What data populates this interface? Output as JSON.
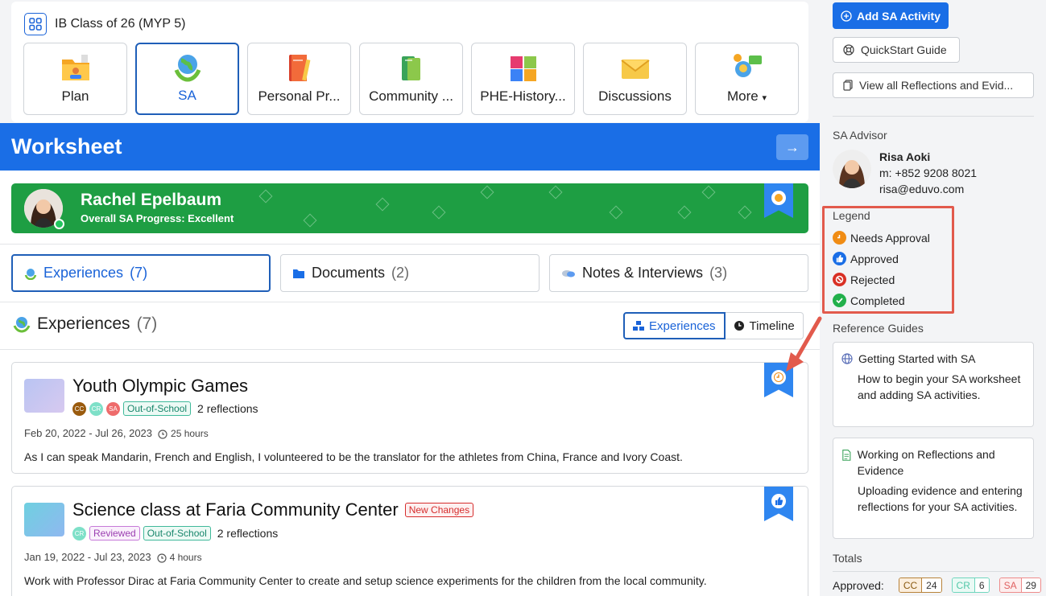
{
  "class_card": {
    "title": "IB Class of 26 (MYP 5)",
    "tabs": [
      {
        "label": "Plan",
        "icon": "folder-person-icon",
        "active": false
      },
      {
        "label": "SA",
        "icon": "globe-hands-icon",
        "active": true
      },
      {
        "label": "Personal Pr...",
        "icon": "notebook-pencil-icon",
        "active": false
      },
      {
        "label": "Community ...",
        "icon": "books-icon",
        "active": false
      },
      {
        "label": "PHE-History...",
        "icon": "puzzle-icon",
        "active": false
      },
      {
        "label": "Discussions",
        "icon": "envelope-icon",
        "active": false
      },
      {
        "label": "More",
        "icon": "idea-chat-icon",
        "active": false
      }
    ]
  },
  "worksheet": {
    "title": "Worksheet",
    "student": {
      "name": "Rachel Epelbaum",
      "progress": "Overall SA Progress: Excellent"
    },
    "subtabs": [
      {
        "label": "Experiences",
        "count": "(7)",
        "icon": "globe-hands-icon",
        "active": true
      },
      {
        "label": "Documents",
        "count": "(2)",
        "icon": "folder-icon",
        "active": false
      },
      {
        "label": "Notes & Interviews",
        "count": "(3)",
        "icon": "chat-icon",
        "active": false
      }
    ],
    "section": {
      "title": "Experiences",
      "count": "(7)"
    },
    "view_toggle": {
      "experiences": "Experiences",
      "timeline": "Timeline"
    },
    "experiences": [
      {
        "title": "Youth Olympic Games",
        "badge": "",
        "strands": [
          "CC",
          "CR",
          "SA"
        ],
        "tags": [
          "Out-of-School"
        ],
        "reflections": "2 reflections",
        "dates": "Feb 20, 2022 - Jul 26, 2023",
        "hours": "25 hours",
        "description": "As I can speak Mandarin, French and English, I volunteered to be the translator for the athletes from China, France and Ivory Coast.",
        "status": "needs-approval"
      },
      {
        "title": "Science class at Faria Community Center",
        "badge": "New Changes",
        "strands": [
          "CR"
        ],
        "tags": [
          "Reviewed",
          "Out-of-School"
        ],
        "reflections": "2 reflections",
        "dates": "Jan 19, 2022 - Jul 23, 2023",
        "hours": "4 hours",
        "description": "Work with Professor Dirac at Faria Community Center to create and setup science experiments for the children from the local community.",
        "status": "approved"
      }
    ]
  },
  "sidebar": {
    "add_button": "Add SA Activity",
    "quickstart": "QuickStart Guide",
    "view_all": "View all Reflections and Evid...",
    "advisor": {
      "heading": "SA Advisor",
      "name": "Risa Aoki",
      "phone": "m: +852 9208 8021",
      "email": "risa@eduvo.com"
    },
    "legend": {
      "heading": "Legend",
      "items": [
        {
          "label": "Needs Approval",
          "color": "#f08c14"
        },
        {
          "label": "Approved",
          "color": "#1a6ee6"
        },
        {
          "label": "Rejected",
          "color": "#d93025"
        },
        {
          "label": "Completed",
          "color": "#22b04b"
        }
      ]
    },
    "reference": {
      "heading": "Reference Guides",
      "guides": [
        {
          "title": "Getting Started with SA",
          "description": "How to begin your SA worksheet and adding SA activities."
        },
        {
          "title": "Working on Reflections and Evidence",
          "description": "Uploading evidence and entering reflections for your SA activities."
        }
      ]
    },
    "totals": {
      "heading": "Totals",
      "approved_label": "Approved:",
      "chips": [
        {
          "code": "CC",
          "value": "24"
        },
        {
          "code": "CR",
          "value": "6"
        },
        {
          "code": "SA",
          "value": "29"
        }
      ]
    }
  }
}
